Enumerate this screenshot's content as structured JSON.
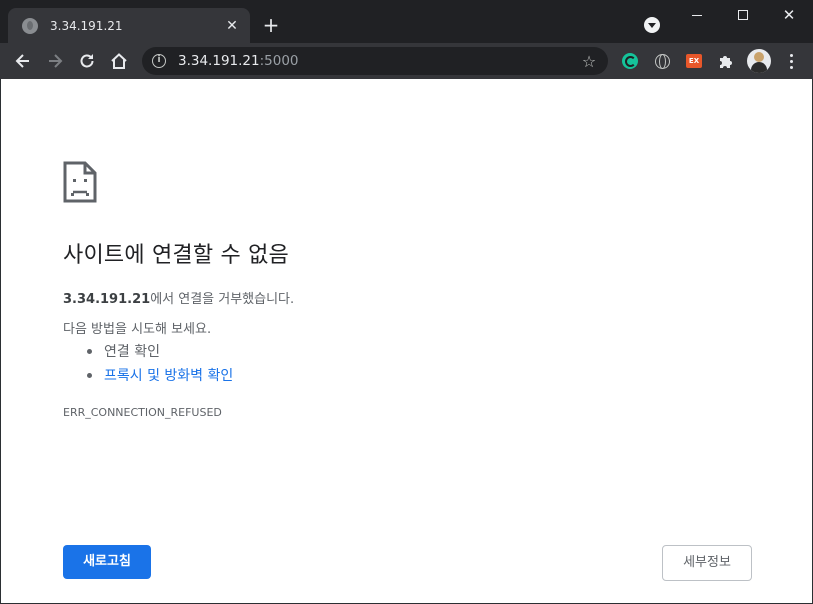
{
  "tab": {
    "title": "3.34.191.21",
    "close_glyph": "✕",
    "new_tab_glyph": "+"
  },
  "window_controls": {
    "close_glyph": "✕"
  },
  "omnibox": {
    "host": "3.34.191.21",
    "port": ":5000",
    "info_glyph": "i",
    "star_glyph": "☆"
  },
  "extensions": {
    "ex_label": "EX"
  },
  "error_page": {
    "title": "사이트에 연결할 수 없음",
    "host_bold": "3.34.191.21",
    "refused_suffix": "에서 연결을 거부했습니다.",
    "try_text": "다음 방법을 시도해 보세요.",
    "suggestions": [
      {
        "label": "연결 확인",
        "is_link": false
      },
      {
        "label": "프록시 및 방화벽 확인",
        "is_link": true
      }
    ],
    "error_code": "ERR_CONNECTION_REFUSED",
    "reload_label": "새로고침",
    "details_label": "세부정보"
  },
  "colors": {
    "accent_blue": "#1a73e8",
    "frame_dark": "#202124",
    "toolbar": "#35363a"
  }
}
